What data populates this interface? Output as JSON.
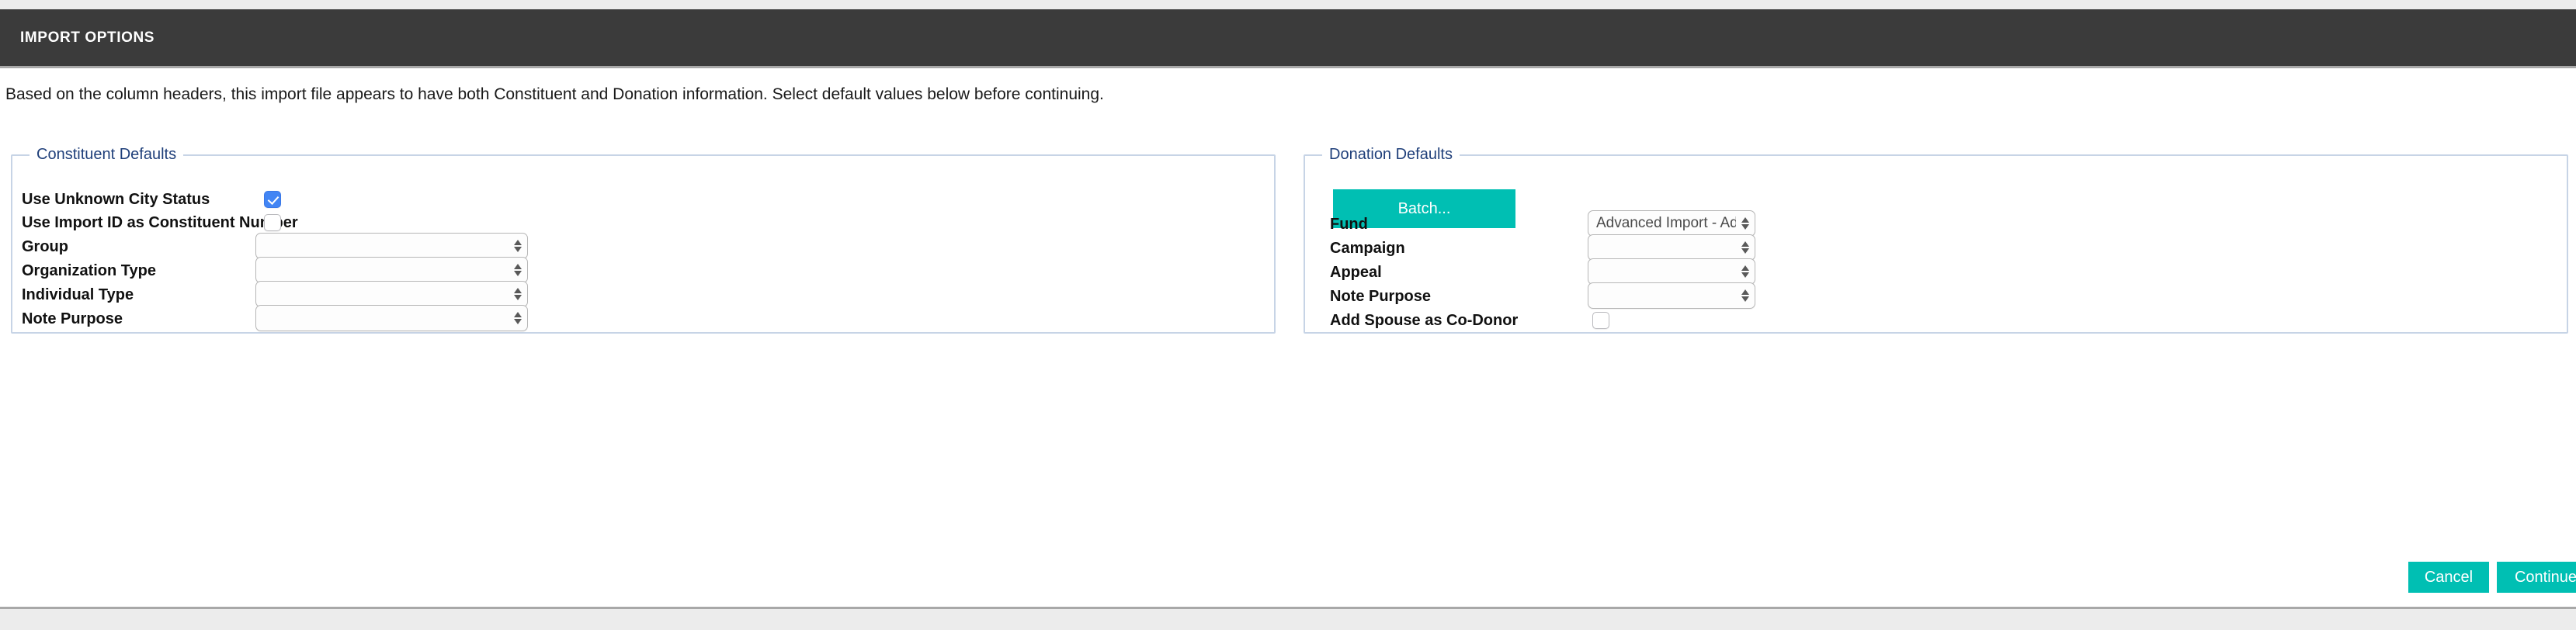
{
  "header": {
    "title": "IMPORT OPTIONS"
  },
  "intro": {
    "text": "Based on the column headers, this import file appears to have both Constituent and Donation information. Select default values below before continuing."
  },
  "constituent": {
    "legend": "Constituent Defaults",
    "rows": [
      {
        "label": "Use Unknown City Status",
        "type": "checkbox",
        "checked": true
      },
      {
        "label": "Use Import ID as Constituent Number",
        "type": "checkbox",
        "checked": false
      },
      {
        "label": "Group",
        "type": "select",
        "value": ""
      },
      {
        "label": "Organization Type",
        "type": "select",
        "value": ""
      },
      {
        "label": "Individual Type",
        "type": "select",
        "value": ""
      },
      {
        "label": "Note Purpose",
        "type": "select",
        "value": ""
      }
    ]
  },
  "donation": {
    "legend": "Donation Defaults",
    "batch_label": "Batch...",
    "rows": [
      {
        "label": "Fund",
        "type": "select",
        "value": "Advanced Import - Advanced Import"
      },
      {
        "label": "Campaign",
        "type": "select",
        "value": ""
      },
      {
        "label": "Appeal",
        "type": "select",
        "value": ""
      },
      {
        "label": "Note Purpose",
        "type": "select",
        "value": ""
      },
      {
        "label": "Add Spouse as Co-Donor",
        "type": "checkbox",
        "checked": false
      }
    ]
  },
  "footer": {
    "cancel_label": "Cancel",
    "continue_label": "Continue"
  },
  "colors": {
    "titlebar_bg": "#3b3b3b",
    "accent_teal": "#00bfb3",
    "legend_blue": "#1f3f7a",
    "fieldset_border": "#c7d4e6",
    "checkbox_checked": "#4285f4"
  }
}
